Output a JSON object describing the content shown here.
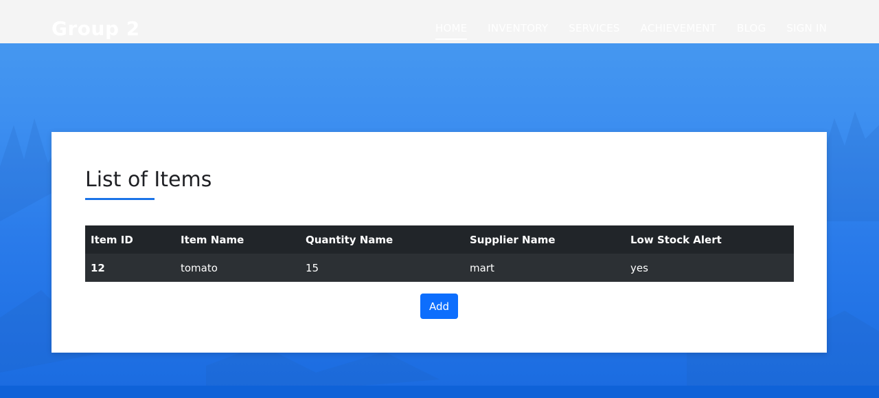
{
  "navbar": {
    "brand": "Group 2",
    "links": [
      {
        "label": "HOME",
        "active": true
      },
      {
        "label": "INVENTORY",
        "active": false
      },
      {
        "label": "SERVICES",
        "active": false
      },
      {
        "label": "ACHIEVEMENT",
        "active": false
      },
      {
        "label": "BLOG",
        "active": false
      },
      {
        "label": "SIGN IN",
        "active": false
      }
    ]
  },
  "main": {
    "title": "List of Items",
    "table": {
      "headers": [
        "Item ID",
        "Item Name",
        "Quantity Name",
        "Supplier Name",
        "Low Stock Alert"
      ],
      "rows": [
        [
          "12",
          "tomato",
          "15",
          "mart",
          "yes"
        ]
      ]
    },
    "add_label": "Add"
  },
  "colors": {
    "accent": "#0d6efd",
    "title_underline": "#1a73e8",
    "table_header_bg": "#212529",
    "table_row_bg": "#2c3034",
    "background_blue": "#3d8ff0",
    "navbar_bg": "#f4f4f4"
  }
}
